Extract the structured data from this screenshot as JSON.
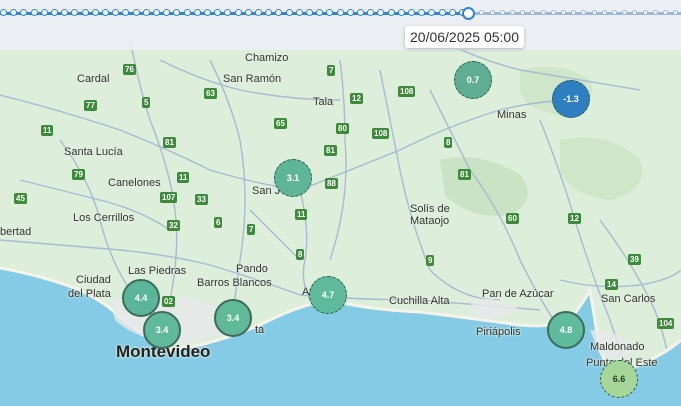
{
  "timeline": {
    "datetime": "20/06/2025 05:00",
    "progress": 0.69
  },
  "places": [
    {
      "name": "Chamizo"
    },
    {
      "name": "Cardal"
    },
    {
      "name": "San Ramón"
    },
    {
      "name": "Tala"
    },
    {
      "name": "Minas"
    },
    {
      "name": "Santa Lucía"
    },
    {
      "name": "Canelones"
    },
    {
      "name": "Los Cerrillos"
    },
    {
      "name": "bertad"
    },
    {
      "name": "Solís de"
    },
    {
      "name": "Mataojo"
    },
    {
      "name": "Las Piedras"
    },
    {
      "name": "Pando"
    },
    {
      "name": "Barros Blancos"
    },
    {
      "name": "Ciudad"
    },
    {
      "name": "del Plata"
    },
    {
      "name": "Cuchilla Alta"
    },
    {
      "name": "Pan de Azúcar"
    },
    {
      "name": "San Carlos"
    },
    {
      "name": "Piriápolis"
    },
    {
      "name": "Maldonado"
    },
    {
      "name": "Punta del Este"
    },
    {
      "name": "Montevideo"
    },
    {
      "name": "San J"
    },
    {
      "name": "Atl"
    },
    {
      "name": "ta"
    }
  ],
  "routes": [
    "76",
    "7",
    "5",
    "63",
    "77",
    "12",
    "108",
    "11",
    "81",
    "65",
    "80",
    "8",
    "108",
    "81",
    "79",
    "11",
    "88",
    "81",
    "45",
    "107",
    "33",
    "11",
    "60",
    "12",
    "32",
    "6",
    "7",
    "8",
    "9",
    "39",
    "14",
    "104",
    "02"
  ],
  "markers": [
    {
      "value": "0.7",
      "color": "#5fae93"
    },
    {
      "value": "-1.3",
      "color": "#2f7fc0"
    },
    {
      "value": "3.1",
      "color": "#5fb597"
    },
    {
      "value": "4.4",
      "color": "#5bb699"
    },
    {
      "value": "3.4",
      "color": "#5fb99a"
    },
    {
      "value": "3.4",
      "color": "#60ba9a"
    },
    {
      "value": "4.7",
      "color": "#5fba9b"
    },
    {
      "value": "4.8",
      "color": "#5fbb9c"
    },
    {
      "value": "6.6",
      "color": "#a6d79a"
    }
  ]
}
